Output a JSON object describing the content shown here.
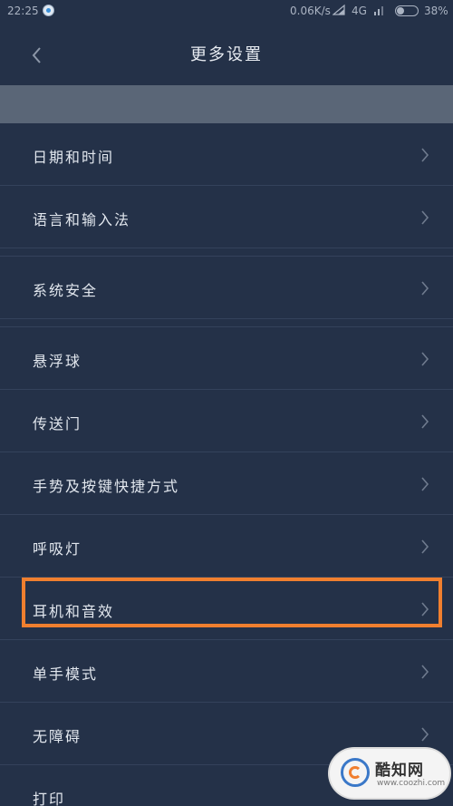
{
  "status_bar": {
    "time": "22:25",
    "speed": "0.06K/s",
    "network": "4G",
    "battery_percent": "38%",
    "battery_level": 0.38
  },
  "header": {
    "back_icon": "chevron-left-icon",
    "title": "更多设置"
  },
  "settings": {
    "group1": [
      {
        "label": "日期和时间"
      },
      {
        "label": "语言和输入法"
      }
    ],
    "group2": [
      {
        "label": "系统安全"
      }
    ],
    "group3": [
      {
        "label": "悬浮球"
      },
      {
        "label": "传送门"
      },
      {
        "label": "手势及按键快捷方式"
      },
      {
        "label": "呼吸灯"
      },
      {
        "label": "耳机和音效"
      },
      {
        "label": "单手模式"
      },
      {
        "label": "无障碍"
      },
      {
        "label": "打印"
      }
    ],
    "highlighted_item": "耳机和音效",
    "chevron_icon": "chevron-right-icon"
  },
  "watermark": {
    "brand": "酷知网",
    "url": "www.coozhi.com"
  },
  "colors": {
    "background": "#243148",
    "band": "#5a6677",
    "highlight": "#f07f2f",
    "text": "#e2e7ee"
  }
}
